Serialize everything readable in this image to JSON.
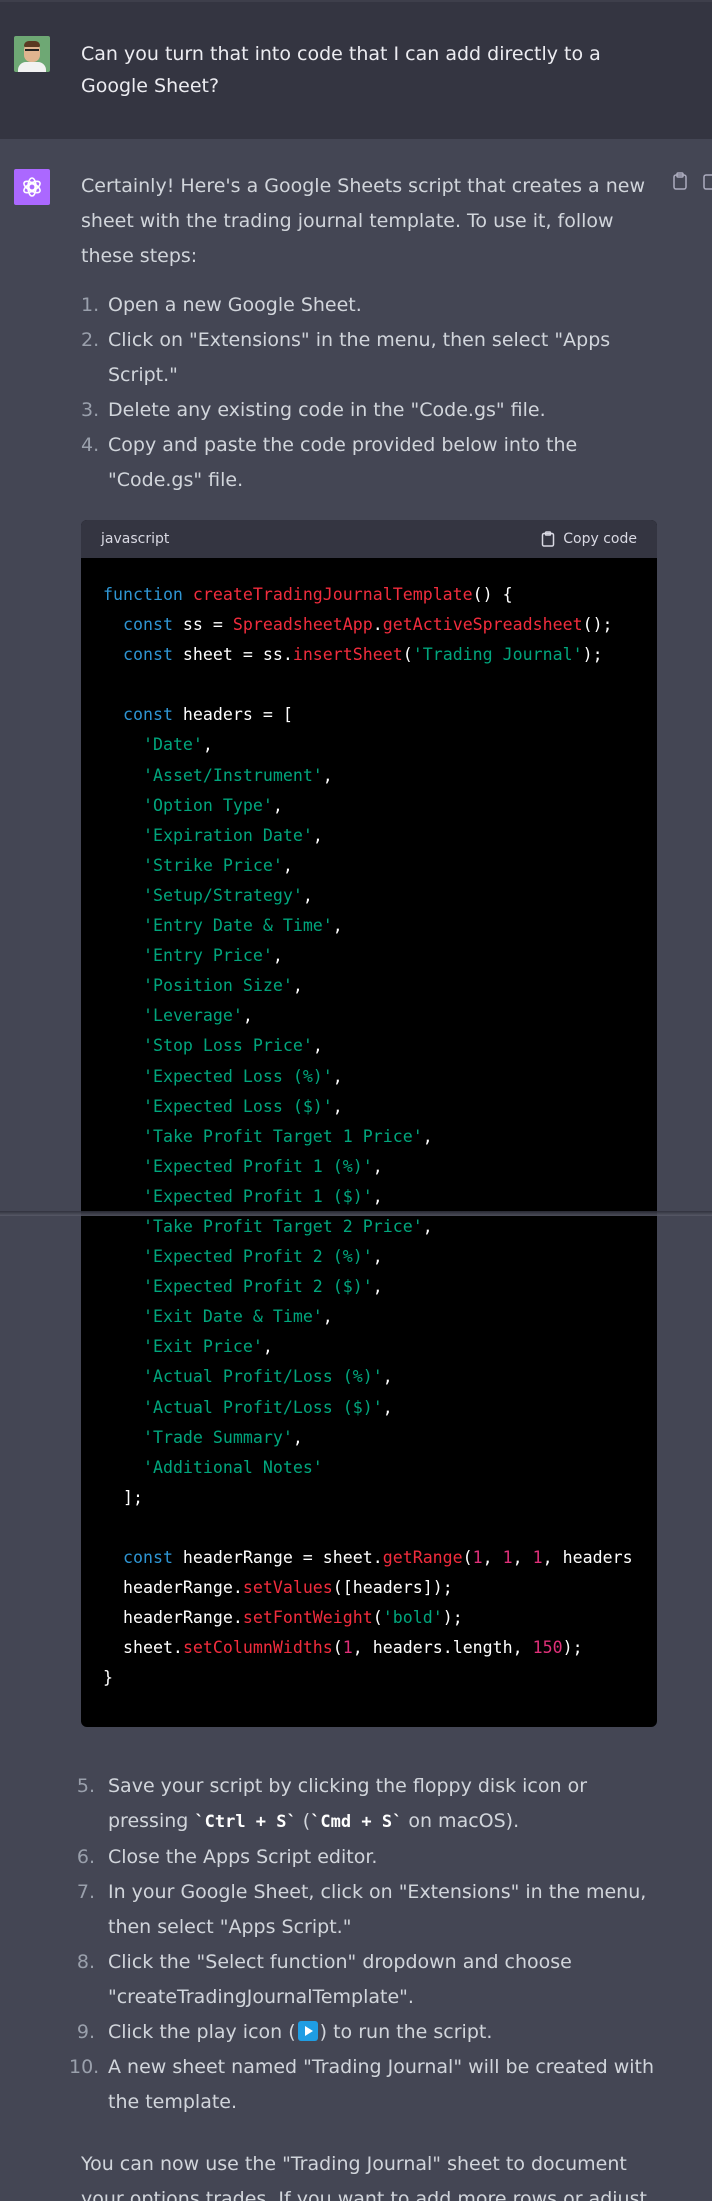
{
  "user_message": "Can you turn that into code that I can add directly to a Google Sheet?",
  "assistant": {
    "intro": "Certainly! Here's a Google Sheets script that creates a new sheet with the trading journal template. To use it, follow these steps:",
    "steps_before": [
      {
        "num": "1.",
        "text": "Open a new Google Sheet."
      },
      {
        "num": "2.",
        "text": "Click on \"Extensions\" in the menu, then select \"Apps Script.\""
      },
      {
        "num": "3.",
        "text": "Delete any existing code in the \"Code.gs\" file."
      },
      {
        "num": "4.",
        "text": "Copy and paste the code provided below into the \"Code.gs\" file."
      }
    ],
    "code_block": {
      "language": "javascript",
      "copy_label": "Copy code",
      "lines": [
        [
          [
            "kw",
            "function "
          ],
          [
            "fn",
            "createTradingJournalTemplate"
          ],
          [
            "p",
            "() {"
          ]
        ],
        [
          [
            "p",
            "  "
          ],
          [
            "kw",
            "const"
          ],
          [
            "p",
            " ss = "
          ],
          [
            "fn",
            "SpreadsheetApp"
          ],
          [
            "p",
            "."
          ],
          [
            "fn",
            "getActiveSpreadsheet"
          ],
          [
            "p",
            "();"
          ]
        ],
        [
          [
            "p",
            "  "
          ],
          [
            "kw",
            "const"
          ],
          [
            "p",
            " sheet = ss."
          ],
          [
            "fn",
            "insertSheet"
          ],
          [
            "p",
            "("
          ],
          [
            "str",
            "'Trading Journal'"
          ],
          [
            "p",
            ");"
          ]
        ],
        [
          [
            "p",
            ""
          ]
        ],
        [
          [
            "p",
            "  "
          ],
          [
            "kw",
            "const"
          ],
          [
            "p",
            " headers = ["
          ]
        ],
        [
          [
            "p",
            "    "
          ],
          [
            "str",
            "'Date'"
          ],
          [
            "p",
            ","
          ]
        ],
        [
          [
            "p",
            "    "
          ],
          [
            "str",
            "'Asset/Instrument'"
          ],
          [
            "p",
            ","
          ]
        ],
        [
          [
            "p",
            "    "
          ],
          [
            "str",
            "'Option Type'"
          ],
          [
            "p",
            ","
          ]
        ],
        [
          [
            "p",
            "    "
          ],
          [
            "str",
            "'Expiration Date'"
          ],
          [
            "p",
            ","
          ]
        ],
        [
          [
            "p",
            "    "
          ],
          [
            "str",
            "'Strike Price'"
          ],
          [
            "p",
            ","
          ]
        ],
        [
          [
            "p",
            "    "
          ],
          [
            "str",
            "'Setup/Strategy'"
          ],
          [
            "p",
            ","
          ]
        ],
        [
          [
            "p",
            "    "
          ],
          [
            "str",
            "'Entry Date & Time'"
          ],
          [
            "p",
            ","
          ]
        ],
        [
          [
            "p",
            "    "
          ],
          [
            "str",
            "'Entry Price'"
          ],
          [
            "p",
            ","
          ]
        ],
        [
          [
            "p",
            "    "
          ],
          [
            "str",
            "'Position Size'"
          ],
          [
            "p",
            ","
          ]
        ],
        [
          [
            "p",
            "    "
          ],
          [
            "str",
            "'Leverage'"
          ],
          [
            "p",
            ","
          ]
        ],
        [
          [
            "p",
            "    "
          ],
          [
            "str",
            "'Stop Loss Price'"
          ],
          [
            "p",
            ","
          ]
        ],
        [
          [
            "p",
            "    "
          ],
          [
            "str",
            "'Expected Loss (%)'"
          ],
          [
            "p",
            ","
          ]
        ],
        [
          [
            "p",
            "    "
          ],
          [
            "str",
            "'Expected Loss ($)'"
          ],
          [
            "p",
            ","
          ]
        ],
        [
          [
            "p",
            "    "
          ],
          [
            "str",
            "'Take Profit Target 1 Price'"
          ],
          [
            "p",
            ","
          ]
        ],
        [
          [
            "p",
            "    "
          ],
          [
            "str",
            "'Expected Profit 1 (%)'"
          ],
          [
            "p",
            ","
          ]
        ],
        [
          [
            "p",
            "    "
          ],
          [
            "str",
            "'Expected Profit 1 ($)'"
          ],
          [
            "p",
            ","
          ]
        ],
        [
          [
            "p",
            "    "
          ],
          [
            "str",
            "'Take Profit Target 2 Price'"
          ],
          [
            "p",
            ","
          ]
        ],
        [
          [
            "p",
            "    "
          ],
          [
            "str",
            "'Expected Profit 2 (%)'"
          ],
          [
            "p",
            ","
          ]
        ],
        [
          [
            "p",
            "    "
          ],
          [
            "str",
            "'Expected Profit 2 ($)'"
          ],
          [
            "p",
            ","
          ]
        ],
        [
          [
            "p",
            "    "
          ],
          [
            "str",
            "'Exit Date & Time'"
          ],
          [
            "p",
            ","
          ]
        ],
        [
          [
            "p",
            "    "
          ],
          [
            "str",
            "'Exit Price'"
          ],
          [
            "p",
            ","
          ]
        ],
        [
          [
            "p",
            "    "
          ],
          [
            "str",
            "'Actual Profit/Loss (%)'"
          ],
          [
            "p",
            ","
          ]
        ],
        [
          [
            "p",
            "    "
          ],
          [
            "str",
            "'Actual Profit/Loss ($)'"
          ],
          [
            "p",
            ","
          ]
        ],
        [
          [
            "p",
            "    "
          ],
          [
            "str",
            "'Trade Summary'"
          ],
          [
            "p",
            ","
          ]
        ],
        [
          [
            "p",
            "    "
          ],
          [
            "str",
            "'Additional Notes'"
          ]
        ],
        [
          [
            "p",
            "  ];"
          ]
        ],
        [
          [
            "p",
            ""
          ]
        ],
        [
          [
            "p",
            "  "
          ],
          [
            "kw",
            "const"
          ],
          [
            "p",
            " headerRange = sheet."
          ],
          [
            "fn",
            "getRange"
          ],
          [
            "p",
            "("
          ],
          [
            "num2",
            "1"
          ],
          [
            "p",
            ", "
          ],
          [
            "num2",
            "1"
          ],
          [
            "p",
            ", "
          ],
          [
            "num2",
            "1"
          ],
          [
            "p",
            ", headers"
          ]
        ],
        [
          [
            "p",
            "  headerRange."
          ],
          [
            "fn",
            "setValues"
          ],
          [
            "p",
            "([headers]);"
          ]
        ],
        [
          [
            "p",
            "  headerRange."
          ],
          [
            "fn",
            "setFontWeight"
          ],
          [
            "p",
            "("
          ],
          [
            "str",
            "'bold'"
          ],
          [
            "p",
            ");"
          ]
        ],
        [
          [
            "p",
            "  sheet."
          ],
          [
            "fn",
            "setColumnWidths"
          ],
          [
            "p",
            "("
          ],
          [
            "num2",
            "1"
          ],
          [
            "p",
            ", headers.length, "
          ],
          [
            "num2",
            "150"
          ],
          [
            "p",
            ");"
          ]
        ],
        [
          [
            "p",
            "}"
          ]
        ]
      ]
    },
    "step5": {
      "num": "5.",
      "pre": "Save your script by clicking the floppy disk icon or pressing ",
      "code1": "`Ctrl + S`",
      "mid": " (",
      "code2": "`Cmd + S`",
      "post": " on macOS)."
    },
    "steps_after": [
      {
        "num": "6.",
        "text": "Close the Apps Script editor."
      },
      {
        "num": "7.",
        "text": "In your Google Sheet, click on \"Extensions\" in the menu, then select \"Apps Script.\""
      },
      {
        "num": "8.",
        "text": "Click the \"Select function\" dropdown and choose \"createTradingJournalTemplate\"."
      }
    ],
    "step9": {
      "num": "9.",
      "pre": "Click the play icon (",
      "post": ") to run the script."
    },
    "step10": {
      "num": "10.",
      "text": "A new sheet named \"Trading Journal\" will be created with the template."
    },
    "outro": "You can now use the \"Trading Journal\" sheet to document your options trades. If you want to add more rows or adjust the formatting, feel free to do so directly in the Google Sheet."
  }
}
